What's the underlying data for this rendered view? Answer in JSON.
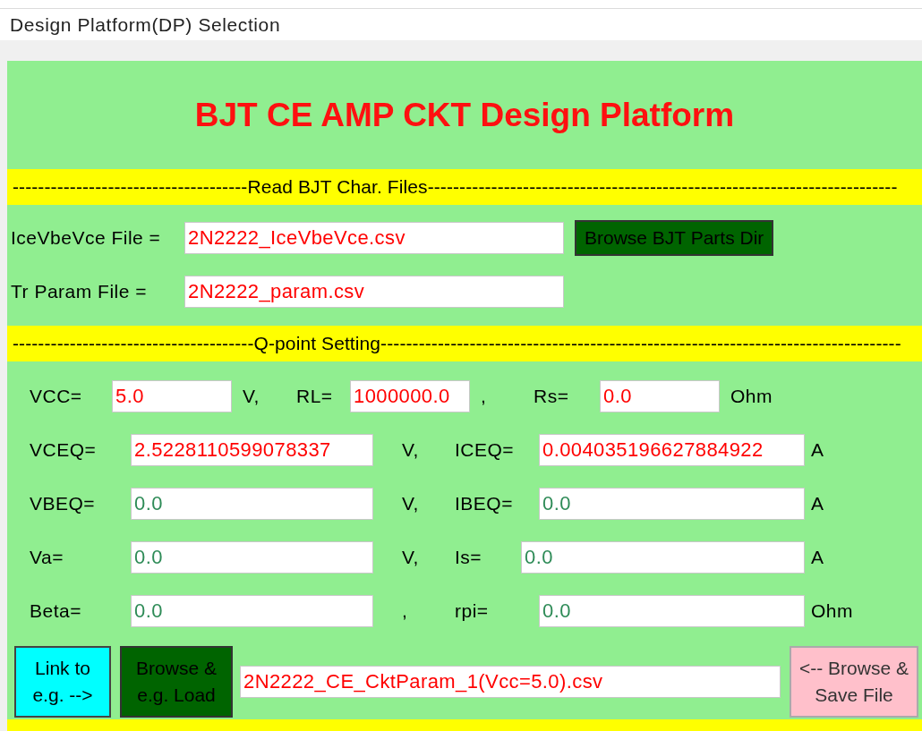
{
  "window": {
    "title": "Design Platform(DP) Selection"
  },
  "heading": "BJT CE AMP CKT Design Platform",
  "section_1": "-------------------------------------Read BJT Char. Files--------------------------------------------------------------------------",
  "files": [
    {
      "label": "IceVbeVce File =",
      "value": "2N2222_IceVbeVce.csv"
    },
    {
      "label": "Tr Param File =",
      "value": "2N2222_param.csv"
    }
  ],
  "browse_parts_button": "Browse BJT Parts Dir",
  "section_2": "--------------------------------------Q-point Setting----------------------------------------------------------------------------------",
  "supply_row": [
    {
      "label": "VCC=",
      "value": "5.0",
      "color": "#ff0000",
      "unit": "V,"
    },
    {
      "label": "RL=",
      "value": "1000000.0",
      "color": "#ff0000",
      "unit": ","
    },
    {
      "label": "Rs=",
      "value": "0.0",
      "color": "#ff0000",
      "unit": "Ohm"
    }
  ],
  "q_rows": [
    {
      "cells": [
        {
          "label": "VCEQ=",
          "value": "2.5228110599078337",
          "color": "#ff0000",
          "unit": "V,"
        },
        {
          "label": "ICEQ=",
          "value": "0.004035196627884922",
          "color": "#ff0000",
          "unit": "A"
        }
      ]
    },
    {
      "cells": [
        {
          "label": "VBEQ=",
          "value": "0.0",
          "color": "#2e8b57",
          "unit": "V,"
        },
        {
          "label": "IBEQ=",
          "value": "0.0",
          "color": "#2e8b57",
          "unit": "A"
        }
      ]
    },
    {
      "cells": [
        {
          "label": "Va=",
          "value": "0.0",
          "color": "#2e8b57",
          "unit": "V,"
        },
        {
          "label": "Is=",
          "value": "0.0",
          "color": "#2e8b57",
          "unit": "A"
        }
      ]
    },
    {
      "cells": [
        {
          "label": "Beta=",
          "value": "0.0",
          "color": "#2e8b57",
          "unit": ","
        },
        {
          "label": "rpi=",
          "value": "0.0",
          "color": "#2e8b57",
          "unit": "Ohm"
        }
      ]
    }
  ],
  "link_button": "Link to e.g. -->",
  "load_button": "Browse & e.g. Load",
  "param_file": "2N2222_CE_CktParam_1(Vcc=5.0).csv",
  "save_button": "<-- Browse & Save File"
}
